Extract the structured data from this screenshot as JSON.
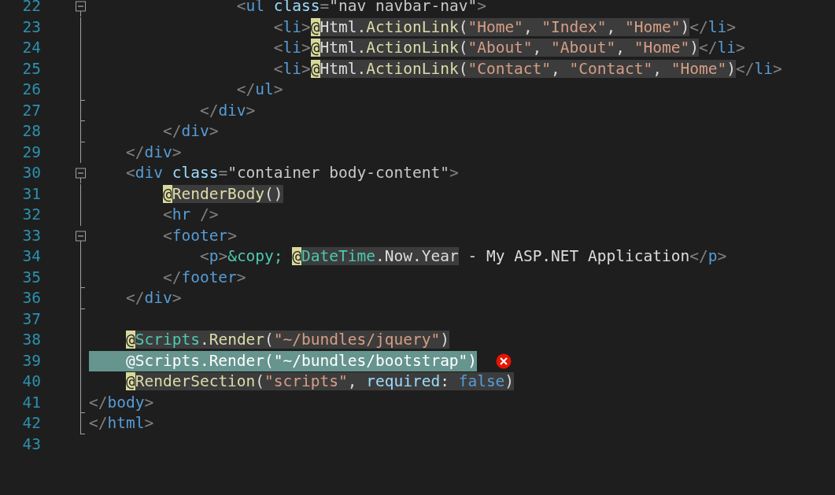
{
  "editor": {
    "lines": [
      {
        "number": "22",
        "kind": "fold_start",
        "selected": false,
        "error": false,
        "tokens": [
          {
            "kind": "punct",
            "text": "                <"
          },
          {
            "kind": "tag",
            "text": "ul "
          },
          {
            "kind": "attr",
            "text": "class"
          },
          {
            "kind": "punct",
            "text": "="
          },
          {
            "kind": "value",
            "text": "\"nav navbar-nav\""
          },
          {
            "kind": "punct",
            "text": ">"
          }
        ]
      },
      {
        "number": "23",
        "kind": "fold_line",
        "selected": false,
        "error": false,
        "tokens": [
          {
            "kind": "punct",
            "text": "                    <"
          },
          {
            "kind": "tag",
            "text": "li"
          },
          {
            "kind": "punct",
            "text": ">"
          },
          {
            "kind": "razor",
            "tokens": [
              {
                "kind": "at",
                "text": "@"
              },
              {
                "kind": "text",
                "text": "Html"
              },
              {
                "kind": "text",
                "text": "."
              },
              {
                "kind": "method",
                "text": "ActionLink"
              },
              {
                "kind": "text",
                "text": "("
              },
              {
                "kind": "string",
                "text": "\"Home\""
              },
              {
                "kind": "text",
                "text": ", "
              },
              {
                "kind": "string",
                "text": "\"Index\""
              },
              {
                "kind": "text",
                "text": ", "
              },
              {
                "kind": "string",
                "text": "\"Home\""
              },
              {
                "kind": "text",
                "text": ")"
              }
            ]
          },
          {
            "kind": "punct",
            "text": "</"
          },
          {
            "kind": "tag",
            "text": "li"
          },
          {
            "kind": "punct",
            "text": ">"
          }
        ]
      },
      {
        "number": "24",
        "kind": "fold_line",
        "selected": false,
        "error": false,
        "tokens": [
          {
            "kind": "punct",
            "text": "                    <"
          },
          {
            "kind": "tag",
            "text": "li"
          },
          {
            "kind": "punct",
            "text": ">"
          },
          {
            "kind": "razor",
            "tokens": [
              {
                "kind": "at",
                "text": "@"
              },
              {
                "kind": "text",
                "text": "Html"
              },
              {
                "kind": "text",
                "text": "."
              },
              {
                "kind": "method",
                "text": "ActionLink"
              },
              {
                "kind": "text",
                "text": "("
              },
              {
                "kind": "string",
                "text": "\"About\""
              },
              {
                "kind": "text",
                "text": ", "
              },
              {
                "kind": "string",
                "text": "\"About\""
              },
              {
                "kind": "text",
                "text": ", "
              },
              {
                "kind": "string",
                "text": "\"Home\""
              },
              {
                "kind": "text",
                "text": ")"
              }
            ]
          },
          {
            "kind": "punct",
            "text": "</"
          },
          {
            "kind": "tag",
            "text": "li"
          },
          {
            "kind": "punct",
            "text": ">"
          }
        ]
      },
      {
        "number": "25",
        "kind": "fold_line",
        "selected": false,
        "error": false,
        "tokens": [
          {
            "kind": "punct",
            "text": "                    <"
          },
          {
            "kind": "tag",
            "text": "li"
          },
          {
            "kind": "punct",
            "text": ">"
          },
          {
            "kind": "razor",
            "tokens": [
              {
                "kind": "at",
                "text": "@"
              },
              {
                "kind": "text",
                "text": "Html"
              },
              {
                "kind": "text",
                "text": "."
              },
              {
                "kind": "method",
                "text": "ActionLink"
              },
              {
                "kind": "text",
                "text": "("
              },
              {
                "kind": "string",
                "text": "\"Contact\""
              },
              {
                "kind": "text",
                "text": ", "
              },
              {
                "kind": "string",
                "text": "\"Contact\""
              },
              {
                "kind": "text",
                "text": ", "
              },
              {
                "kind": "string",
                "text": "\"Home\""
              },
              {
                "kind": "text",
                "text": ")"
              }
            ]
          },
          {
            "kind": "punct",
            "text": "</"
          },
          {
            "kind": "tag",
            "text": "li"
          },
          {
            "kind": "punct",
            "text": ">"
          }
        ]
      },
      {
        "number": "26",
        "kind": "fold_end",
        "selected": false,
        "error": false,
        "tokens": [
          {
            "kind": "punct",
            "text": "                </"
          },
          {
            "kind": "tag",
            "text": "ul"
          },
          {
            "kind": "punct",
            "text": ">"
          }
        ]
      },
      {
        "number": "27",
        "kind": "fold_end",
        "selected": false,
        "error": false,
        "tokens": [
          {
            "kind": "punct",
            "text": "            </"
          },
          {
            "kind": "tag",
            "text": "div"
          },
          {
            "kind": "punct",
            "text": ">"
          }
        ]
      },
      {
        "number": "28",
        "kind": "fold_end",
        "selected": false,
        "error": false,
        "tokens": [
          {
            "kind": "punct",
            "text": "        </"
          },
          {
            "kind": "tag",
            "text": "div"
          },
          {
            "kind": "punct",
            "text": ">"
          }
        ]
      },
      {
        "number": "29",
        "kind": "fold_line",
        "selected": false,
        "error": false,
        "tokens": [
          {
            "kind": "punct",
            "text": "    </"
          },
          {
            "kind": "tag",
            "text": "div"
          },
          {
            "kind": "punct",
            "text": ">"
          }
        ]
      },
      {
        "number": "30",
        "kind": "fold_start",
        "selected": false,
        "error": false,
        "tokens": [
          {
            "kind": "punct",
            "text": "    <"
          },
          {
            "kind": "tag",
            "text": "div "
          },
          {
            "kind": "attr",
            "text": "class"
          },
          {
            "kind": "punct",
            "text": "="
          },
          {
            "kind": "value",
            "text": "\"container body-content\""
          },
          {
            "kind": "punct",
            "text": ">"
          }
        ]
      },
      {
        "number": "31",
        "kind": "fold_line",
        "selected": false,
        "error": false,
        "tokens": [
          {
            "kind": "razor",
            "tokens": [
              {
                "kind": "at",
                "text": "        @"
              },
              {
                "kind": "method",
                "text": "RenderBody"
              },
              {
                "kind": "text",
                "text": "()"
              }
            ]
          }
        ]
      },
      {
        "number": "32",
        "kind": "fold_line",
        "selected": false,
        "error": false,
        "tokens": [
          {
            "kind": "punct",
            "text": "        <"
          },
          {
            "kind": "tag",
            "text": "hr "
          },
          {
            "kind": "punct",
            "text": "/>"
          }
        ]
      },
      {
        "number": "33",
        "kind": "fold_start",
        "selected": false,
        "error": false,
        "tokens": [
          {
            "kind": "punct",
            "text": "        <"
          },
          {
            "kind": "tag",
            "text": "footer"
          },
          {
            "kind": "punct",
            "text": ">"
          }
        ]
      },
      {
        "number": "34",
        "kind": "fold_line",
        "selected": false,
        "error": false,
        "tokens": [
          {
            "kind": "punct",
            "text": "            <"
          },
          {
            "kind": "tag",
            "text": "p"
          },
          {
            "kind": "punct",
            "text": ">"
          },
          {
            "kind": "entity",
            "text": "&copy; "
          },
          {
            "kind": "razor",
            "tokens": [
              {
                "kind": "at",
                "text": "@"
              },
              {
                "kind": "type",
                "text": "DateTime"
              },
              {
                "kind": "text",
                "text": "."
              },
              {
                "kind": "text",
                "text": "Now"
              },
              {
                "kind": "text",
                "text": "."
              },
              {
                "kind": "text",
                "text": "Year"
              }
            ]
          },
          {
            "kind": "text",
            "text": " - My ASP.NET Application"
          },
          {
            "kind": "punct",
            "text": "</"
          },
          {
            "kind": "tag",
            "text": "p"
          },
          {
            "kind": "punct",
            "text": ">"
          }
        ]
      },
      {
        "number": "35",
        "kind": "fold_end",
        "selected": false,
        "error": false,
        "tokens": [
          {
            "kind": "punct",
            "text": "        </"
          },
          {
            "kind": "tag",
            "text": "footer"
          },
          {
            "kind": "punct",
            "text": ">"
          }
        ]
      },
      {
        "number": "36",
        "kind": "fold_end",
        "selected": false,
        "error": false,
        "tokens": [
          {
            "kind": "punct",
            "text": "    </"
          },
          {
            "kind": "tag",
            "text": "div"
          },
          {
            "kind": "punct",
            "text": ">"
          }
        ]
      },
      {
        "number": "37",
        "kind": "fold_line",
        "selected": false,
        "error": false
      },
      {
        "number": "38",
        "kind": "fold_line",
        "selected": false,
        "error": false,
        "tokens": [
          {
            "kind": "razor",
            "tokens": [
              {
                "kind": "at",
                "text": "    @"
              },
              {
                "kind": "type",
                "text": "Scripts"
              },
              {
                "kind": "text",
                "text": "."
              },
              {
                "kind": "method",
                "text": "Render"
              },
              {
                "kind": "text",
                "text": "("
              },
              {
                "kind": "string",
                "text": "\"~/bundles/jquery\""
              },
              {
                "kind": "text",
                "text": ")"
              }
            ]
          }
        ]
      },
      {
        "number": "39",
        "kind": "fold_line",
        "selected": true,
        "error": true,
        "tokens": [
          {
            "kind": "text",
            "text": "    @Scripts.Render(\"~/bundles/bootstrap\")"
          }
        ]
      },
      {
        "number": "40",
        "kind": "fold_line",
        "selected": false,
        "error": false,
        "tokens": [
          {
            "kind": "razor",
            "tokens": [
              {
                "kind": "at",
                "text": "    @"
              },
              {
                "kind": "method",
                "text": "RenderSection"
              },
              {
                "kind": "text",
                "text": "("
              },
              {
                "kind": "string",
                "text": "\"scripts\""
              },
              {
                "kind": "text",
                "text": ", "
              },
              {
                "kind": "param",
                "text": "required"
              },
              {
                "kind": "text",
                "text": ": "
              },
              {
                "kind": "keyword",
                "text": "false"
              },
              {
                "kind": "text",
                "text": ")"
              }
            ]
          }
        ]
      },
      {
        "number": "41",
        "kind": "fold_end",
        "selected": false,
        "error": false,
        "tokens": [
          {
            "kind": "punct",
            "text": "</"
          },
          {
            "kind": "tag",
            "text": "body"
          },
          {
            "kind": "punct",
            "text": ">"
          }
        ]
      },
      {
        "number": "42",
        "kind": "fold_end",
        "selected": false,
        "error": false,
        "tokens": [
          {
            "kind": "punct",
            "text": "</"
          },
          {
            "kind": "tag",
            "text": "html"
          },
          {
            "kind": "punct",
            "text": ">"
          }
        ]
      },
      {
        "number": "43",
        "kind": "plain",
        "selected": false,
        "error": false
      }
    ]
  }
}
